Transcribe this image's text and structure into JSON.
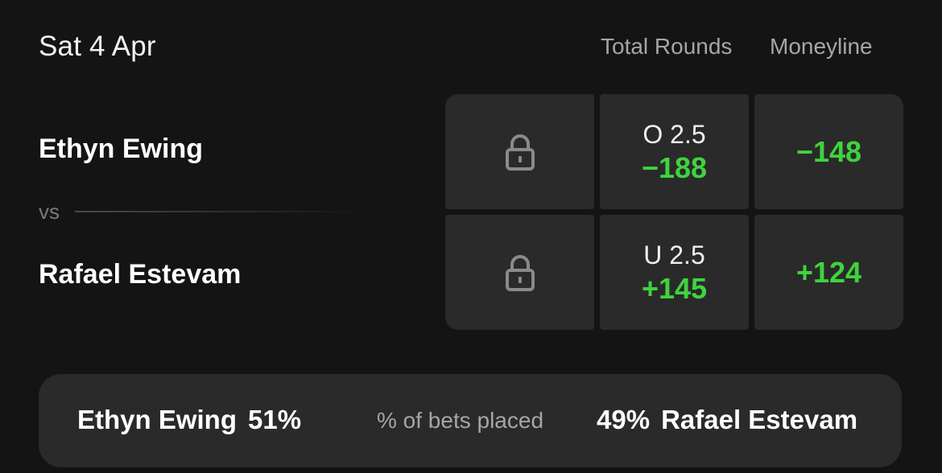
{
  "event": {
    "date": "Sat 4 Apr"
  },
  "columns": {
    "total_rounds": "Total Rounds",
    "moneyline": "Moneyline"
  },
  "matchup": {
    "fighter1": "Ethyn Ewing",
    "vs_label": "vs",
    "fighter2": "Rafael Estevam"
  },
  "markets": {
    "row1": {
      "prop_icon": "lock-icon",
      "rounds_label": "O 2.5",
      "rounds_odds": "−188",
      "moneyline_odds": "−148"
    },
    "row2": {
      "prop_icon": "lock-icon",
      "rounds_label": "U 2.5",
      "rounds_odds": "+145",
      "moneyline_odds": "+124"
    }
  },
  "bets_placed": {
    "fighter1": "Ethyn Ewing",
    "fighter1_pct": "51%",
    "label": "% of bets placed",
    "fighter2_pct": "49%",
    "fighter2": "Rafael Estevam"
  },
  "colors": {
    "background": "#141414",
    "cell": "#2a2a2a",
    "odds_green": "#3fd33f",
    "muted_text": "#a6a6a6"
  }
}
